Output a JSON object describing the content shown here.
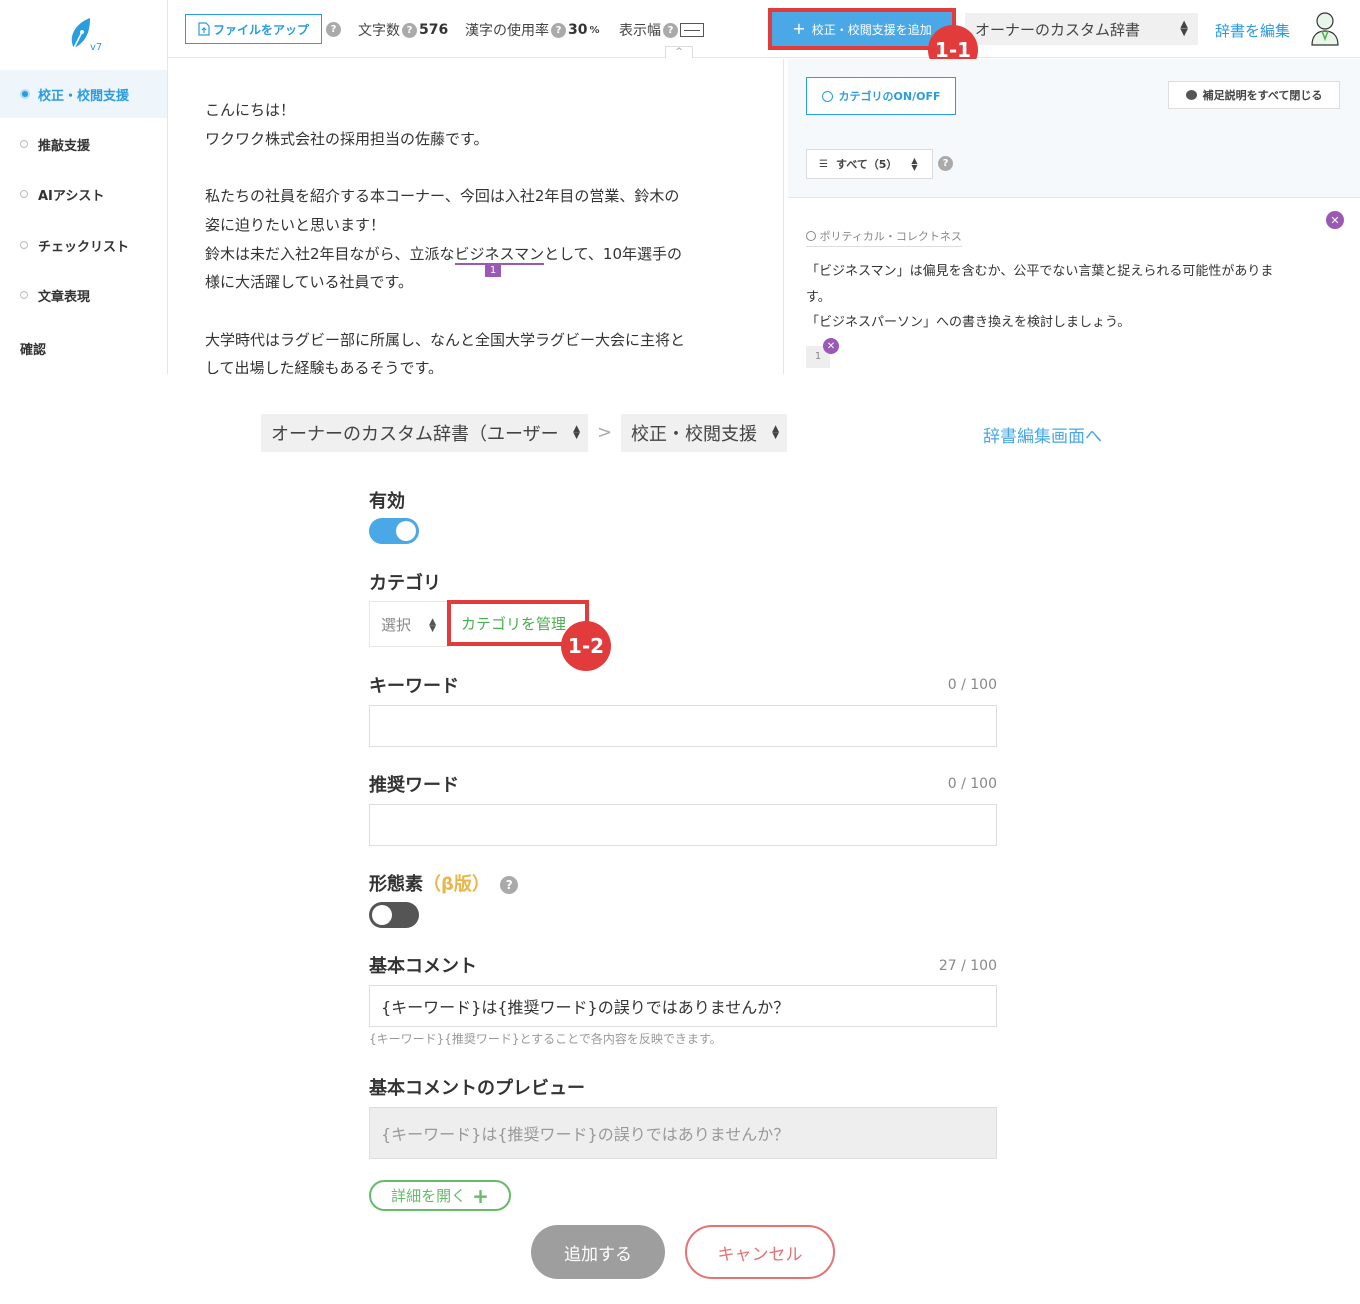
{
  "sidebar": {
    "logo_version": "v7",
    "items": [
      {
        "label": "校正・校閲支援"
      },
      {
        "label": "推敲支援"
      },
      {
        "label": "AIアシスト"
      },
      {
        "label": "チェックリスト"
      },
      {
        "label": "文章表現"
      },
      {
        "label": "確認"
      }
    ]
  },
  "toolbar": {
    "upload_label": "ファイルをアップ",
    "char_count_label": "文字数",
    "char_count_value": "576",
    "kanji_label": "漢字の使用率",
    "kanji_value": "30",
    "kanji_unit": "%",
    "width_label": "表示幅",
    "add_label": "校正・校閲支援を追加",
    "dict_select_value": "オーナーのカスタム辞書",
    "edit_dict_link": "辞書を編集",
    "collapse_glyph": "^"
  },
  "badges": {
    "b1": "1-1",
    "b2": "1-2"
  },
  "editor": {
    "lines": [
      "こんにちは！",
      "ワクワク株式会社の採用担当の佐藤です。",
      "私たちの社員を紹介する本コーナー、今回は入社2年目の営業、鈴木の",
      "姿に迫りたいと思います！",
      "鈴木は未だ入社2年目ながら、立派な",
      "ビジネスマン",
      "として、10年選手の",
      "様に大活躍している社員です。",
      "大学時代はラグビー部に所属し、なんと全国大学ラグビー大会に主将と",
      "して出場した経験もあるそうです。"
    ],
    "highlight_number": "1"
  },
  "right_panel": {
    "category_toggle_label": "カテゴリのON/OFF",
    "close_all_label": "補足説明をすべて閉じる",
    "filter_label": "すべて（5）",
    "card": {
      "tag": "ポリティカル・コレクトネス",
      "line1": "「ビジネスマン」は偏見を含むか、公平でない言葉と捉えられる可能性がありま",
      "line2": "す。",
      "line3": "「ビジネスパーソン」への書き換えを検討しましょう。",
      "number": "1"
    }
  },
  "form": {
    "dict_select": "オーナーのカスタム辞書（ユーザー",
    "type_select": "校正・校閲支援",
    "breadcrumb_sep": ">",
    "to_edit_link": "辞書編集画面へ",
    "enabled_label": "有効",
    "enabled": true,
    "category_label": "カテゴリ",
    "category_select": "選択",
    "category_manage": "カテゴリを管理",
    "keyword_label": "キーワード",
    "keyword_counter": "0 / 100",
    "keyword_value": "",
    "recommended_label": "推奨ワード",
    "recommended_counter": "0 / 100",
    "recommended_value": "",
    "morph_label": "形態素",
    "morph_beta": "（β版）",
    "morph_enabled": false,
    "comment_label": "基本コメント",
    "comment_counter": "27 / 100",
    "comment_value": "{キーワード}は{推奨ワード}の誤りではありませんか？",
    "comment_hint": "{キーワード}{推奨ワード}とすることで各内容を反映できます。",
    "preview_label": "基本コメントのプレビュー",
    "preview_value": "{キーワード}は{推奨ワード}の誤りではありませんか？",
    "details_label": "詳細を開く",
    "submit_label": "追加する",
    "cancel_label": "キャンセル"
  },
  "colors": {
    "accent": "#2a9ce0",
    "highlight_red": "#e23b3b",
    "purple": "#9b59b6",
    "green": "#66bb6a"
  },
  "icons": [
    "pen-nib-logo-icon",
    "file-upload-icon",
    "help-icon",
    "width-icon",
    "plus-icon",
    "user-avatar-icon",
    "check-circle-icon",
    "comment-icon",
    "filter-icon",
    "close-icon"
  ]
}
